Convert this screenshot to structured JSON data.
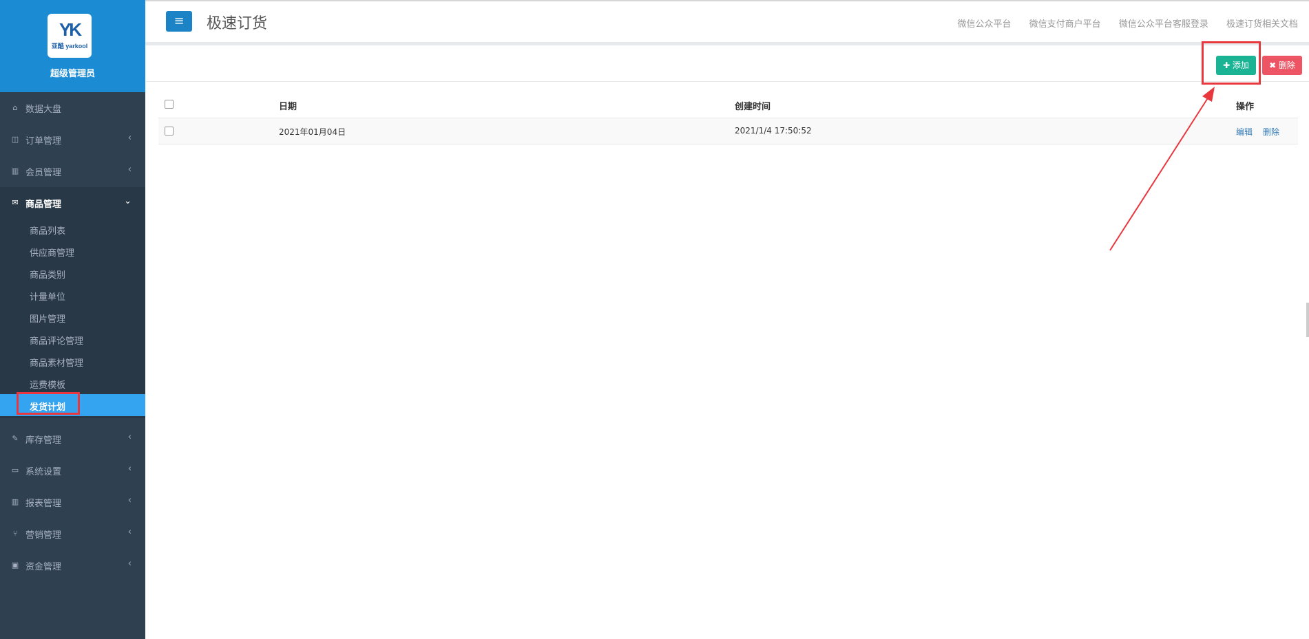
{
  "sidebar": {
    "logo_mark": "YK",
    "logo_text": "亚酷 yarkool",
    "profile_name": "超级管理员",
    "items": [
      {
        "label": "数据大盘",
        "icon": "home-icon"
      },
      {
        "label": "订单管理",
        "icon": "columns-icon"
      },
      {
        "label": "会员管理",
        "icon": "bar-chart-icon"
      },
      {
        "label": "商品管理",
        "icon": "envelope-icon"
      },
      {
        "label": "库存管理",
        "icon": "edit-icon"
      },
      {
        "label": "系统设置",
        "icon": "desktop-icon"
      },
      {
        "label": "报表管理",
        "icon": "bar-chart-icon"
      },
      {
        "label": "营销管理",
        "icon": "cutlery-icon"
      },
      {
        "label": "资金管理",
        "icon": "money-icon"
      }
    ],
    "submenu": [
      "商品列表",
      "供应商管理",
      "商品类别",
      "计量单位",
      "图片管理",
      "商品评论管理",
      "商品素材管理",
      "运费模板",
      "发货计划"
    ],
    "current_submenu": "发货计划"
  },
  "header": {
    "menu_icon": "hamburger-icon",
    "title": "极速订货",
    "links": [
      "微信公众平台",
      "微信支付商户平台",
      "微信公众平台客服登录",
      "极速订货相关文档"
    ]
  },
  "toolbar": {
    "add_label": "✚ 添加",
    "delete_label": "✖ 删除",
    "add_color": "#1ab394",
    "delete_color": "#ed5565"
  },
  "table": {
    "columns": [
      "日期",
      "创建时间",
      "操作"
    ],
    "rows": [
      {
        "date": "2021年01月04日",
        "created": "2021/1/4 17:50:52",
        "actions": [
          "编辑",
          "删除"
        ]
      }
    ]
  },
  "colors": {
    "sidebar_bg": "#2f4050",
    "profile_bg": "#1b8bd4",
    "active_sub_bg": "#34a3f0",
    "annotation": "#e8383e"
  }
}
